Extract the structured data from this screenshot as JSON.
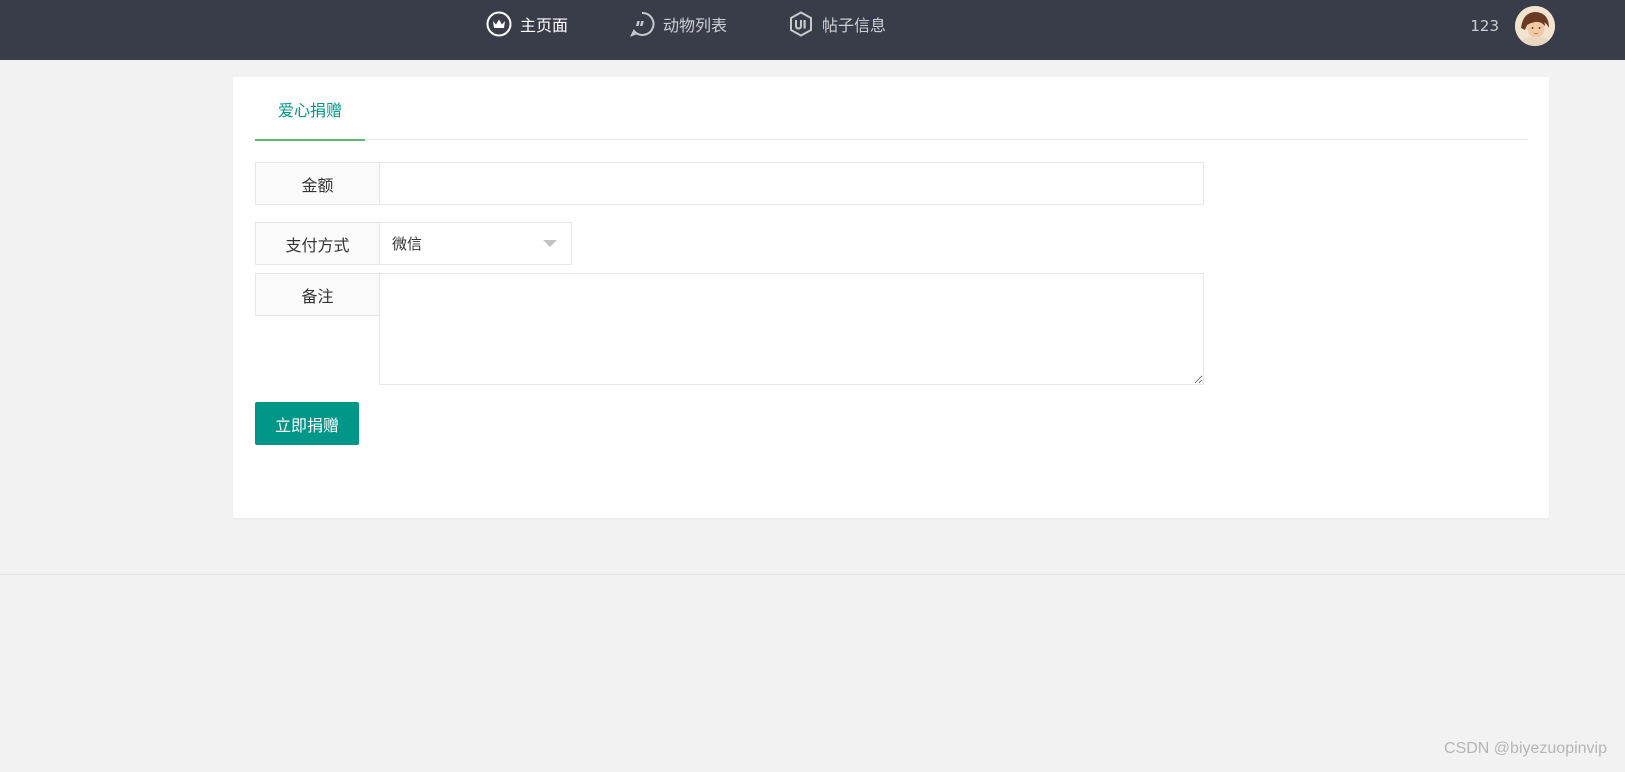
{
  "nav": {
    "items": [
      {
        "label": "主页面",
        "icon": "crown-icon",
        "active": true
      },
      {
        "label": "动物列表",
        "icon": "chat-bubble-icon",
        "active": false
      },
      {
        "label": "帖子信息",
        "icon": "ui-hexagon-icon",
        "active": false
      }
    ]
  },
  "user": {
    "name": "123",
    "avatar_icon": "user-avatar"
  },
  "tab": {
    "label": "爱心捐赠"
  },
  "form": {
    "amount_label": "金额",
    "amount_value": "",
    "payment_label": "支付方式",
    "payment_selected": "微信",
    "note_label": "备注",
    "note_value": "",
    "submit_label": "立即捐赠"
  },
  "watermark": "CSDN @biyezuopinvip",
  "colors": {
    "topbar": "#393d49",
    "accent": "#009688",
    "tab_underline": "#5fb878",
    "background": "#f2f2f2"
  }
}
